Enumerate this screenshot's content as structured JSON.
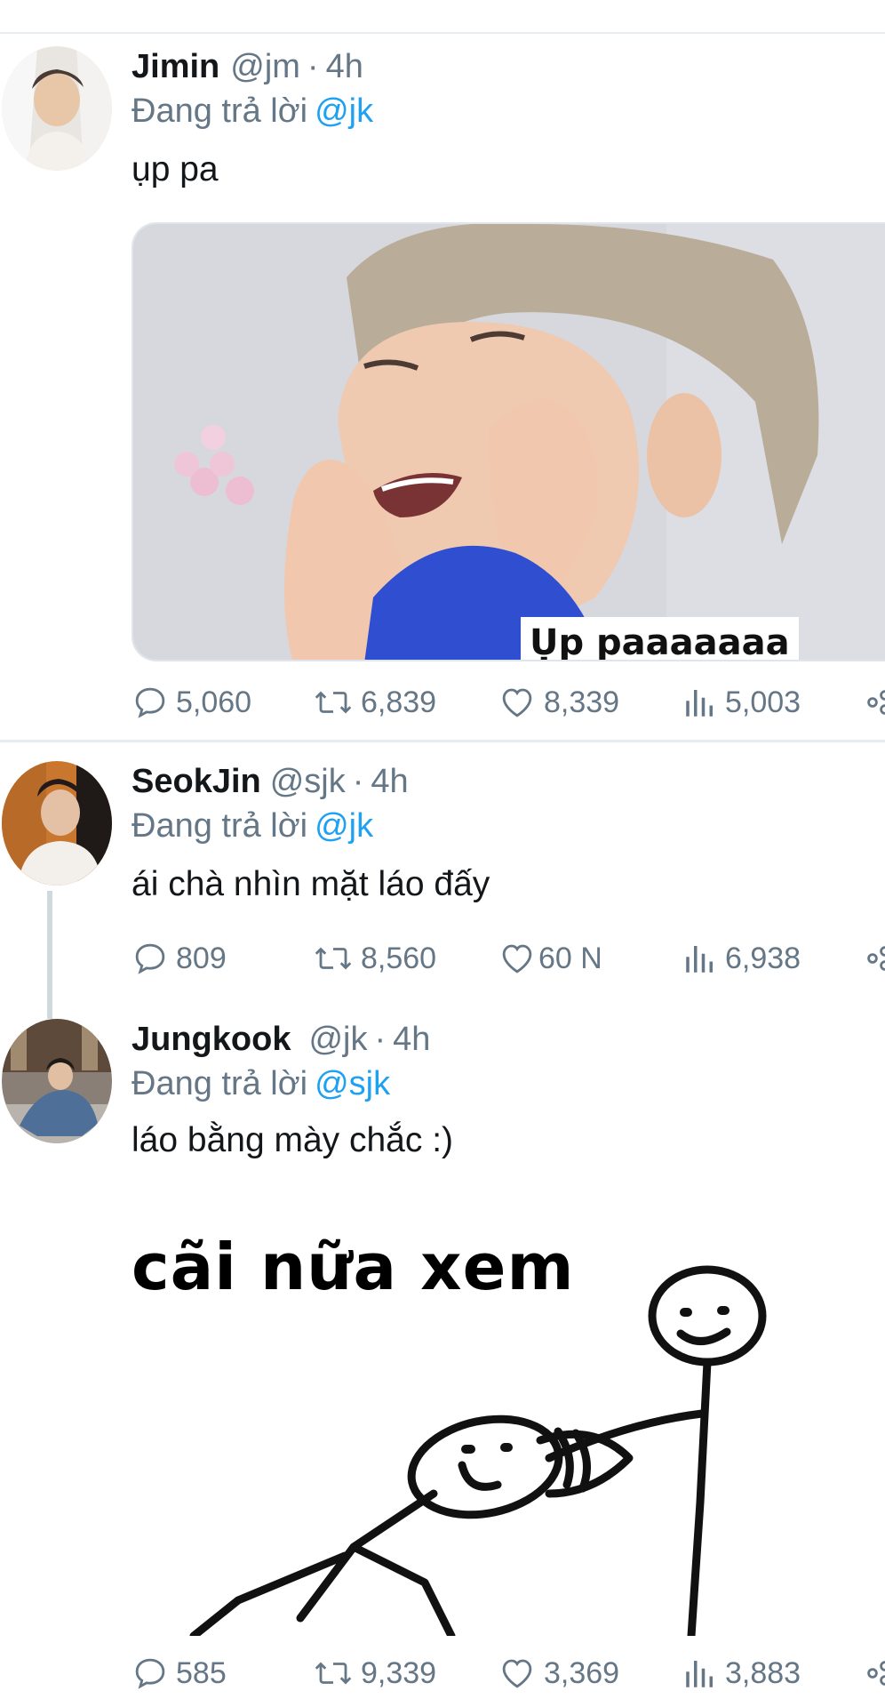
{
  "tweets": [
    {
      "name": "Jimin",
      "handle": "@jm",
      "separator": "·",
      "time": "4h",
      "reply_prefix": "Đang trả lời",
      "reply_to": "@jk",
      "text": "ụp pa",
      "media_caption": "Ụp paaaaaaa",
      "stats": {
        "replies": "5,060",
        "retweets": "6,839",
        "likes": "8,339",
        "views": "5,003"
      }
    },
    {
      "name": "SeokJin",
      "handle": "@sjk",
      "separator": "·",
      "time": "4h",
      "reply_prefix": "Đang trả lời",
      "reply_to": "@jk",
      "text": "ái chà nhìn mặt láo đấy",
      "stats": {
        "replies": "809",
        "retweets": "8,560",
        "likes": "60 N",
        "views": "6,938"
      }
    },
    {
      "name": "Jungkook",
      "handle": "@jk",
      "separator": "·",
      "time": "4h",
      "reply_prefix": "Đang trả lời",
      "reply_to": "@sjk",
      "text": "láo bằng mày chắc :)",
      "media_caption": "cãi nữa xem",
      "stats": {
        "replies": "585",
        "retweets": "9,339",
        "likes": "3,369",
        "views": "3,883"
      }
    }
  ],
  "icons": {
    "reply": "reply-icon",
    "retweet": "retweet-icon",
    "like": "heart-icon",
    "views": "analytics-icon",
    "share": "share-icon"
  },
  "colors": {
    "text": "#14171a",
    "muted": "#657786",
    "mention": "#1da1f2",
    "divider": "#e6ecf0"
  }
}
